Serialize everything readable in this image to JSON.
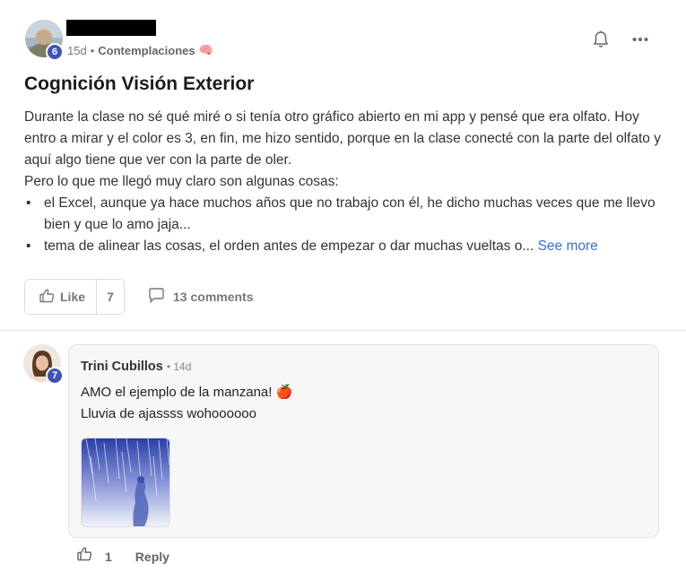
{
  "post": {
    "author_level": "6",
    "time": "15d",
    "separator": "•",
    "category": "Contemplaciones",
    "category_emoji": "🧠",
    "title": "Cognición Visión Exterior",
    "paragraph_1": "Durante la clase no sé qué miré o si tenía otro gráfico abierto en mi app y pensé que era olfato. Hoy entro a mirar y el color es 3, en fin, me hizo sentido, porque en la clase conecté con la parte del olfato y aquí algo tiene que ver con la parte de oler.",
    "paragraph_2": "Pero lo que me llegó muy claro son algunas cosas:",
    "bullet_char": "•",
    "bullet_1": "el Excel, aunque ya hace muchos años que no trabajo con él, he dicho muchas veces que me llevo bien y que lo amo jaja...",
    "bullet_2": "tema de alinear las cosas, el orden antes de empezar o dar muchas vueltas o...",
    "see_more": "See more",
    "like_label": "Like",
    "like_count": "7",
    "comments_label": "13 comments",
    "icons": {
      "bell": "bell-icon",
      "more": "more-horizontal-icon",
      "like": "thumbs-up-icon",
      "comment": "comment-icon"
    }
  },
  "comment": {
    "author": "Trini Cubillos",
    "author_level": "7",
    "time": "• 14d",
    "line_1": "AMO el ejemplo de la manzana! 🍎",
    "line_2": "Lluvia de ajassss wohoooooo",
    "like_count": "1",
    "reply_label": "Reply"
  },
  "colors": {
    "badge": "#3e53b8",
    "link": "#3b6fd6",
    "muted": "#777777"
  }
}
